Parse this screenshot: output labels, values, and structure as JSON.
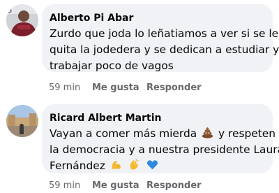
{
  "comments": [
    {
      "author": "Alberto Pi Abar",
      "lines": [
        "Zurdo que joda lo leñatiamos a ver si se les",
        "quita la jodedera y se dedican a estudiar y",
        "trabajar poco de vagos"
      ],
      "time": "59 min",
      "like_label": "Me gusta",
      "reply_label": "Responder"
    },
    {
      "author": "Ricard Albert Martin",
      "lines": [
        "Vayan a comer más mierda",
        "y respeten",
        "la democracia y a nuestra presidente Laura",
        "Fernández"
      ],
      "emojis": [
        "poop-emoji",
        "flexed-biceps-emoji",
        "clapping-hands-emoji",
        "blue-heart-emoji"
      ],
      "time": "59 min",
      "like_label": "Me gusta",
      "reply_label": "Responder"
    }
  ],
  "colors": {
    "bubble": "#f0f2f5",
    "meta_text": "#65676b",
    "text": "#050505"
  }
}
